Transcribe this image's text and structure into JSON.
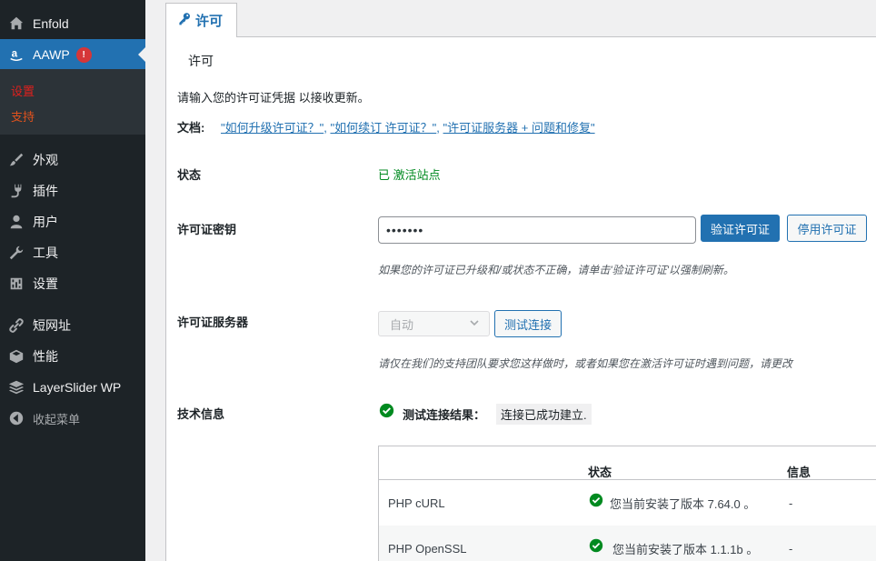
{
  "sidebar": {
    "items": [
      {
        "label": "Enfold",
        "icon": "house-icon"
      },
      {
        "label": "AAWP",
        "icon": "amazon-icon",
        "badge": "!"
      },
      {
        "label": "外观",
        "icon": "paintbrush-icon"
      },
      {
        "label": "插件",
        "icon": "plugin-icon"
      },
      {
        "label": "用户",
        "icon": "user-icon"
      },
      {
        "label": "工具",
        "icon": "wrench-icon"
      },
      {
        "label": "设置",
        "icon": "settings-sliders-icon"
      },
      {
        "label": "短网址",
        "icon": "link-icon"
      },
      {
        "label": "性能",
        "icon": "box-icon"
      },
      {
        "label": "LayerSlider WP",
        "icon": "layers-icon"
      },
      {
        "label": "收起菜单",
        "icon": "collapse-arrow-icon"
      }
    ],
    "submenu": [
      {
        "label": "设置",
        "color": "#e0201d"
      },
      {
        "label": "支持",
        "color": "#e0521d"
      }
    ],
    "active_color": "#2271b1"
  },
  "tab": {
    "label": "许可",
    "icon": "key-icon"
  },
  "panel": {
    "section_title": "许可",
    "intro": "请输入您的许可证凭据 以接收更新。",
    "docs": {
      "label": "文档:",
      "links": [
        "\"如何升级许可证？\"",
        "\"如何续订 许可证？\"",
        "\"许可证服务器 + 问题和修复\""
      ],
      "separator": ","
    },
    "status": {
      "label": "状态",
      "value": "已 激活站点",
      "color": "#008a20"
    },
    "license_key": {
      "label": "许可证密钥",
      "value": "•••••••",
      "verify_button": "验证许可证",
      "deactivate_button": "停用许可证",
      "hint": "如果您的许可证已升级和/或状态不正确，请单击'验证许可证'以强制刷新。"
    },
    "license_server": {
      "label": "许可证服务器",
      "selected": "自动",
      "test_button": "测试连接",
      "hint": "请仅在我们的支持团队要求您这样做时，或者如果您在激活许可证时遇到问题，请更改"
    },
    "tech_info": {
      "label": "技术信息",
      "result_label": "测试连接结果：",
      "result_value": "连接已成功建立.",
      "table": {
        "headers": [
          "状态",
          "信息"
        ],
        "rows": [
          {
            "name": "PHP cURL",
            "status": "您当前安装了版本 7.64.0 。",
            "info": "-"
          },
          {
            "name": "PHP OpenSSL",
            "status": "您当前安装了版本 1.1.1b 。",
            "info": "-"
          }
        ]
      }
    }
  }
}
